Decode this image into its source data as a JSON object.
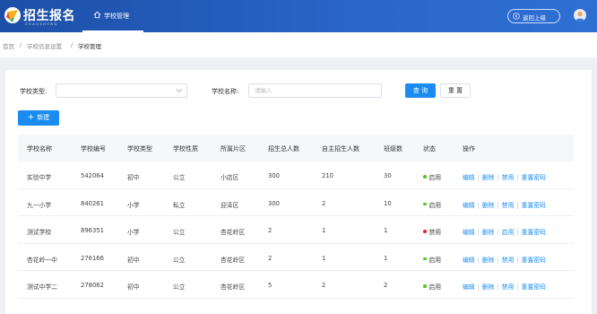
{
  "app": {
    "title": "招生报名",
    "subtitle": "ZHAOSHENG",
    "nav_tab": "学校管理",
    "back_label": "返回上级",
    "brand_color": "#2a66c8"
  },
  "breadcrumb": [
    "首页",
    "学校信息设置",
    "学校管理"
  ],
  "filters": {
    "type_label": "学校类型:",
    "type_value": "",
    "name_label": "学校名称:",
    "name_placeholder": "请输入",
    "search_label": "查 询",
    "reset_label": "重 置"
  },
  "toolbar": {
    "add_label": "新建"
  },
  "table": {
    "columns": [
      "学校名称",
      "学校编号",
      "学校类型",
      "学校性质",
      "所属片区",
      "招生总人数",
      "自主招生人数",
      "班级数",
      "状态",
      "操作"
    ],
    "rows": [
      {
        "name": "实验中学",
        "code": "542064",
        "type": "初中",
        "nature": "公立",
        "area": "小店区",
        "total": "300",
        "self": "210",
        "classes": "30",
        "status": "启用",
        "status_color": "#52c41a",
        "toggle": "禁用"
      },
      {
        "name": "九一小学",
        "code": "840261",
        "type": "小学",
        "nature": "私立",
        "area": "迎泽区",
        "total": "300",
        "self": "2",
        "classes": "10",
        "status": "启用",
        "status_color": "#52c41a",
        "toggle": "禁用"
      },
      {
        "name": "测试学校",
        "code": "896351",
        "type": "小学",
        "nature": "公立",
        "area": "杏花岭区",
        "total": "2",
        "self": "1",
        "classes": "1",
        "status": "禁用",
        "status_color": "#f5222d",
        "toggle": "启用"
      },
      {
        "name": "杏花岭一中",
        "code": "276166",
        "type": "初中",
        "nature": "公立",
        "area": "杏花岭区",
        "total": "2",
        "self": "1",
        "classes": "1",
        "status": "启用",
        "status_color": "#52c41a",
        "toggle": "禁用"
      },
      {
        "name": "测试中学二",
        "code": "278062",
        "type": "初中",
        "nature": "公立",
        "area": "杏花岭区",
        "total": "5",
        "self": "2",
        "classes": "2",
        "status": "启用",
        "status_color": "#52c41a",
        "toggle": "禁用"
      }
    ],
    "ops": {
      "edit": "编辑",
      "delete": "删除",
      "reset_pwd": "重置密码"
    },
    "link_color": "#1a8cf0"
  }
}
